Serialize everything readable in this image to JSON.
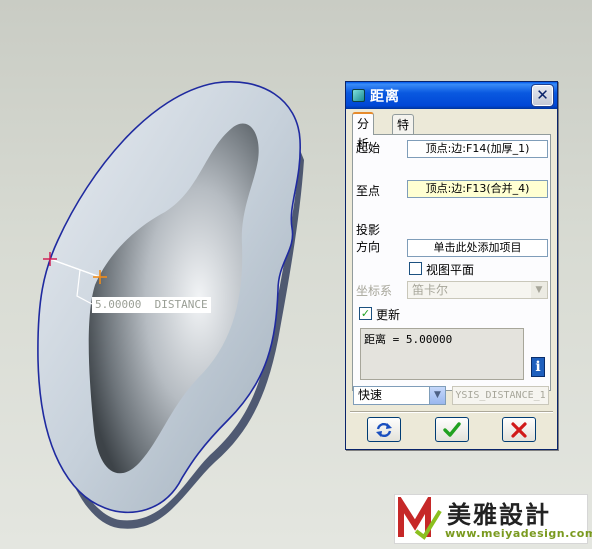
{
  "viewport": {
    "dimension_label": "5.00000  DISTANCE"
  },
  "dialog": {
    "title": "距离",
    "close_glyph": "✕",
    "tabs": [
      {
        "label": "分析",
        "active": true
      },
      {
        "label": "特征",
        "active": false
      }
    ],
    "fields": {
      "start_label": "起始",
      "start_value": "顶点:边:F14(加厚_1)",
      "end_label": "至点",
      "end_value": "顶点:边:F13(合并_4)",
      "projection_label": "投影",
      "direction_label": "方向",
      "direction_value": "单击此处添加项目",
      "view_plane_label": "视图平面",
      "view_plane_checked": false,
      "coord_label": "坐标系",
      "coord_value": "笛卡尔",
      "update_label": "更新",
      "update_checked": true
    },
    "result_text": "距离 = 5.00000",
    "info_glyph": "i",
    "speed_value": "快速",
    "name_value": "YSIS_DISTANCE_1",
    "buttons": {
      "repeat_icon": "repeat-icon",
      "ok_icon": "check-icon",
      "cancel_icon": "x-icon"
    },
    "colors": {
      "title_bar": "#0a59e0",
      "ok_green": "#21a121",
      "cancel_red": "#d11a1a",
      "input_highlight": "#ffffd2"
    }
  },
  "watermark": {
    "title": "美雅設計",
    "url": "www.meiyadesign.com"
  }
}
